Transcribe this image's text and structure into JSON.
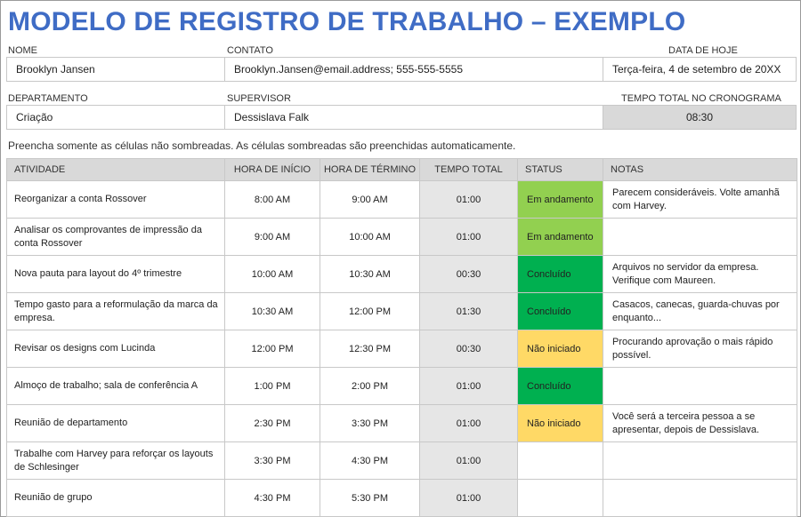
{
  "title": "MODELO DE REGISTRO DE TRABALHO – EXEMPLO",
  "fields": {
    "name_label": "NOME",
    "name_value": "Brooklyn Jansen",
    "contact_label": "CONTATO",
    "contact_value": "Brooklyn.Jansen@email.address; 555-555-5555",
    "date_label": "DATA DE HOJE",
    "date_value": "Terça-feira, 4 de setembro de 20XX",
    "dept_label": "DEPARTAMENTO",
    "dept_value": "Criação",
    "supervisor_label": "SUPERVISOR",
    "supervisor_value": "Dessislava Falk",
    "total_label": "TEMPO TOTAL NO CRONOGRAMA",
    "total_value": "08:30"
  },
  "instruction": "Preencha somente as células não sombreadas. As células sombreadas são preenchidas automaticamente.",
  "table": {
    "headers": [
      "ATIVIDADE",
      "HORA DE INÍCIO",
      "HORA DE TÉRMINO",
      "TEMPO TOTAL",
      "STATUS",
      "NOTAS"
    ],
    "rows": [
      {
        "activity": "Reorganizar a conta Rossover",
        "start": "8:00 AM",
        "end": "9:00 AM",
        "total": "01:00",
        "status": "Em andamento",
        "notes": "Parecem consideráveis. Volte amanhã com Harvey."
      },
      {
        "activity": "Analisar os comprovantes de impressão da conta Rossover",
        "start": "9:00 AM",
        "end": "10:00 AM",
        "total": "01:00",
        "status": "Em andamento",
        "notes": ""
      },
      {
        "activity": "Nova pauta para layout do 4º trimestre",
        "start": "10:00 AM",
        "end": "10:30 AM",
        "total": "00:30",
        "status": "Concluído",
        "notes": "Arquivos no servidor da empresa. Verifique com Maureen."
      },
      {
        "activity": "Tempo gasto para a reformulação da marca da empresa.",
        "start": "10:30 AM",
        "end": "12:00 PM",
        "total": "01:30",
        "status": "Concluído",
        "notes": "Casacos, canecas, guarda-chuvas por enquanto..."
      },
      {
        "activity": "Revisar os designs com Lucinda",
        "start": "12:00 PM",
        "end": "12:30 PM",
        "total": "00:30",
        "status": "Não iniciado",
        "notes": "Procurando aprovação o mais rápido possível."
      },
      {
        "activity": "Almoço de trabalho; sala de conferência A",
        "start": "1:00 PM",
        "end": "2:00 PM",
        "total": "01:00",
        "status": "Concluído",
        "notes": ""
      },
      {
        "activity": "Reunião de departamento",
        "start": "2:30 PM",
        "end": "3:30 PM",
        "total": "01:00",
        "status": "Não iniciado",
        "notes": "Você será a terceira pessoa a se apresentar, depois de Dessislava."
      },
      {
        "activity": "Trabalhe com Harvey para reforçar os layouts de Schlesinger",
        "start": "3:30 PM",
        "end": "4:30 PM",
        "total": "01:00",
        "status": "",
        "notes": ""
      },
      {
        "activity": "Reunião de grupo",
        "start": "4:30 PM",
        "end": "5:30 PM",
        "total": "01:00",
        "status": "",
        "notes": ""
      }
    ]
  },
  "status_colors": {
    "Em andamento": "#92d050",
    "Concluído": "#00b050",
    "Não iniciado": "#ffd966"
  },
  "colors": {
    "title": "#3f6cc5",
    "shade": "#d9d9d9"
  }
}
